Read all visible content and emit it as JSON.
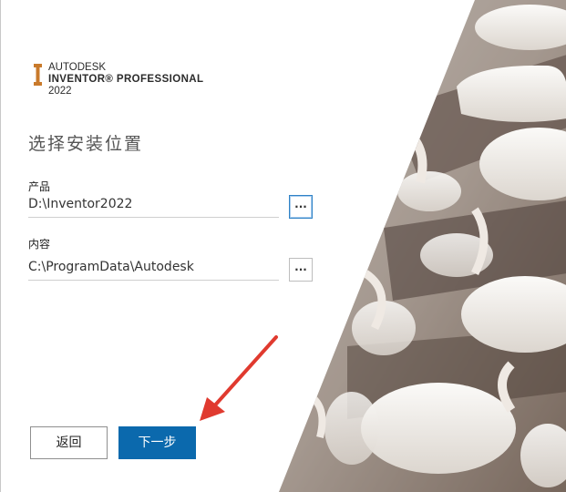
{
  "brand": {
    "company": "AUTODESK",
    "product": "INVENTOR® PROFESSIONAL",
    "year": "2022",
    "accent_color": "#c97a2b"
  },
  "page": {
    "title": "选择安装位置"
  },
  "product_location": {
    "label": "产品",
    "value": "D:\\Inventor2022",
    "browse_label": "..."
  },
  "content_location": {
    "label": "内容",
    "value": "C:\\ProgramData\\Autodesk",
    "browse_label": "..."
  },
  "buttons": {
    "back": "返回",
    "next": "下一步"
  },
  "colors": {
    "primary_button": "#0b69ad",
    "annotation_arrow": "#e03a2f"
  }
}
